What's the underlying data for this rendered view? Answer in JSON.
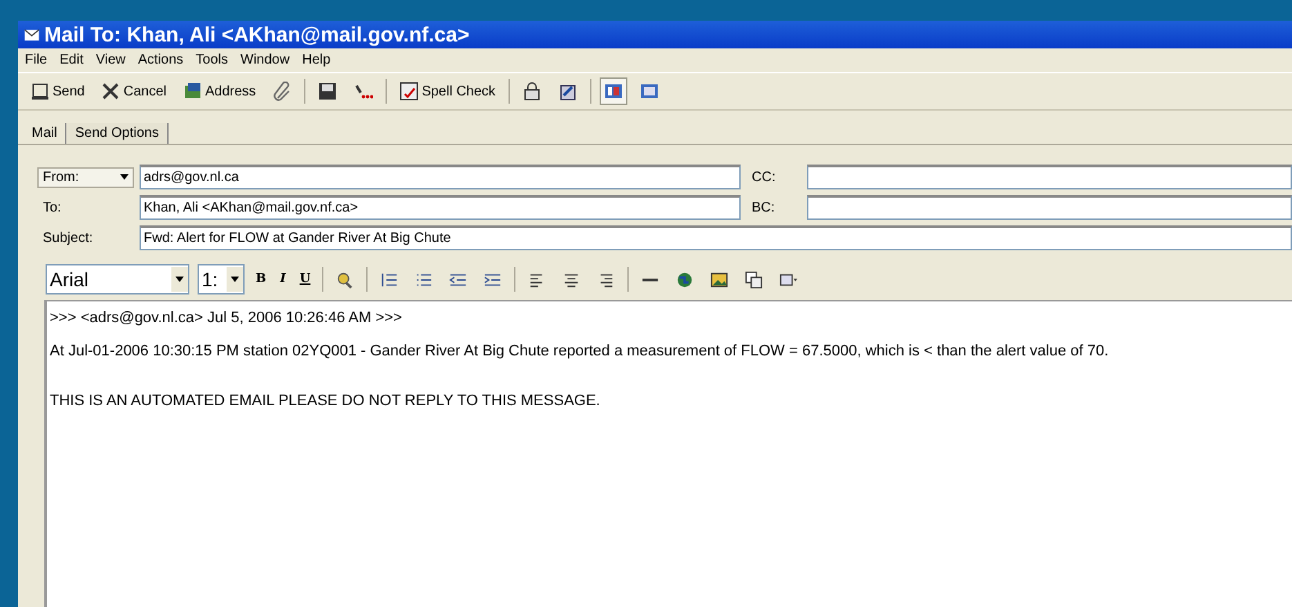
{
  "window": {
    "title": "Mail To: Khan, Ali <AKhan@mail.gov.nf.ca>"
  },
  "menu": [
    "File",
    "Edit",
    "View",
    "Actions",
    "Tools",
    "Window",
    "Help"
  ],
  "toolbar": [
    {
      "kind": "text",
      "label": "Send"
    },
    {
      "kind": "text",
      "label": "Cancel"
    },
    {
      "kind": "text",
      "label": "Address"
    },
    {
      "kind": "icon"
    },
    {
      "kind": "sep"
    },
    {
      "kind": "icon"
    },
    {
      "kind": "icon"
    },
    {
      "kind": "sep"
    },
    {
      "kind": "text",
      "label": "Spell Check"
    },
    {
      "kind": "sep"
    },
    {
      "kind": "icon"
    },
    {
      "kind": "icon"
    },
    {
      "kind": "sep"
    },
    {
      "kind": "toggle",
      "selected": true
    },
    {
      "kind": "toggle",
      "selected": false
    }
  ],
  "tabs": [
    {
      "label": "Mail",
      "selected": true
    },
    {
      "label": "Send Options",
      "selected": false
    }
  ],
  "from": {
    "label": "From:",
    "value": "adrs@gov.nl.ca"
  },
  "to": {
    "label": "To:",
    "value": "Khan, Ali <AKhan@mail.gov.nf.ca>"
  },
  "cc": {
    "label": "CC:"
  },
  "bc": {
    "label": "BC:"
  },
  "subject": {
    "label": "Subject:",
    "value": "Fwd: Alert for FLOW at Gander River At Big Chute"
  },
  "format": {
    "font": "Arial",
    "size": "1:",
    "styles": [
      "B",
      "I",
      "U"
    ]
  },
  "body": [
    ">>> <adrs@gov.nl.ca> Jul 5, 2006 10:26:46 AM >>>",
    "At Jul-01-2006 10:30:15 PM station 02YQ001 - Gander River At Big Chute reported a measurement of FLOW = 67.5000, which is < than the alert value of 70.",
    "THIS IS AN AUTOMATED EMAIL PLEASE DO NOT REPLY TO THIS MESSAGE."
  ]
}
